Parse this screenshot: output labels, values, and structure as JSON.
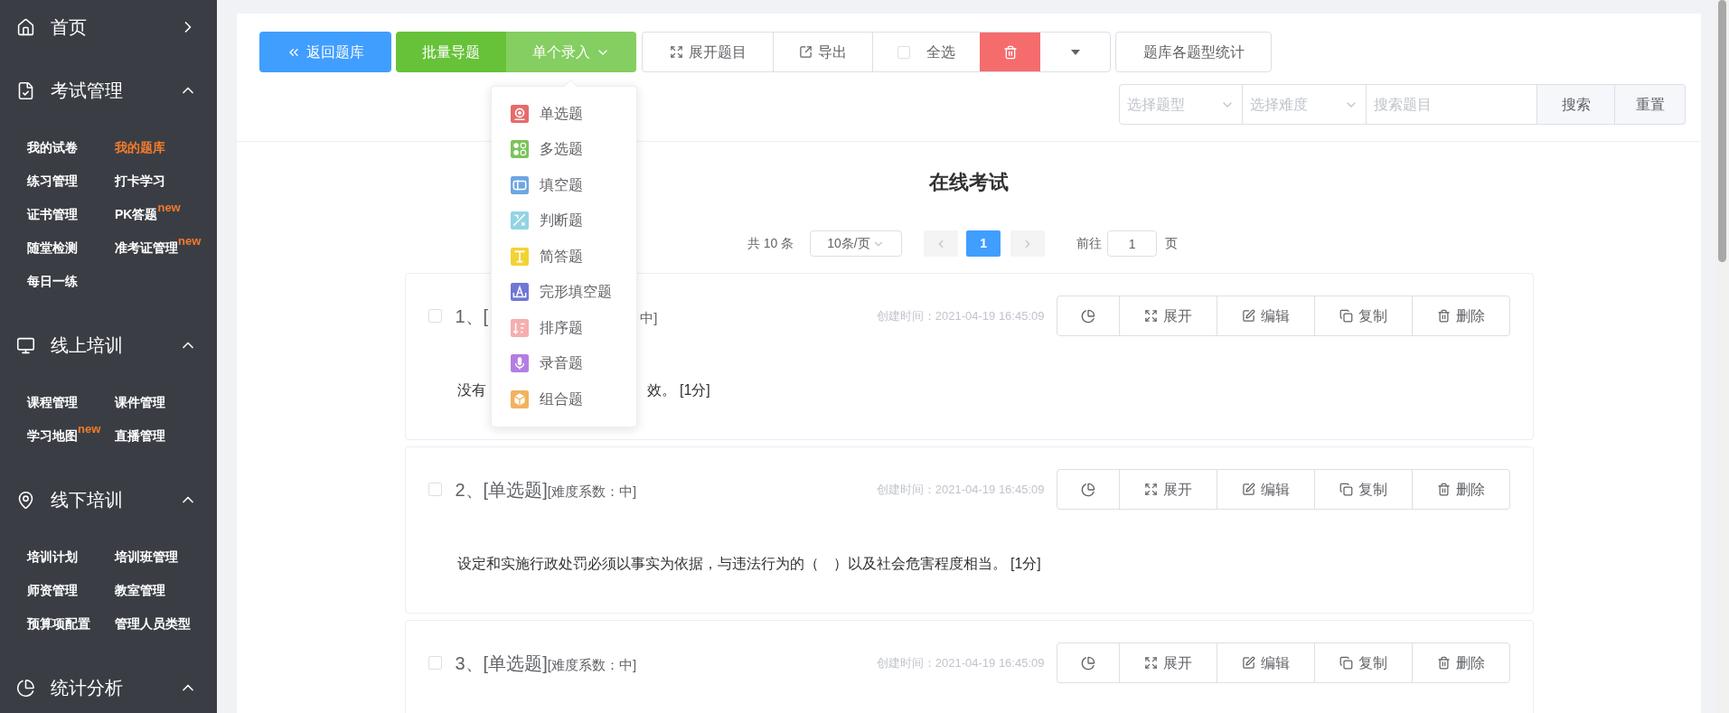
{
  "sidebar": {
    "sections": [
      {
        "label": "首页",
        "expanded": false
      },
      {
        "label": "考试管理",
        "expanded": true,
        "items": [
          {
            "label": "我的试卷",
            "selected": false
          },
          {
            "label": "我的题库",
            "selected": true
          },
          {
            "label": "练习管理",
            "selected": false
          },
          {
            "label": "打卡学习",
            "selected": false
          },
          {
            "label": "证书管理",
            "selected": false
          },
          {
            "label": "PK答题",
            "selected": false,
            "badge": "new"
          },
          {
            "label": "随堂检测",
            "selected": false
          },
          {
            "label": "准考证管理",
            "selected": false,
            "badge": "new"
          },
          {
            "label": "每日一练",
            "selected": false
          }
        ]
      },
      {
        "label": "线上培训",
        "expanded": true,
        "items": [
          {
            "label": "课程管理",
            "selected": false
          },
          {
            "label": "课件管理",
            "selected": false
          },
          {
            "label": "学习地图",
            "selected": false,
            "badge": "new"
          },
          {
            "label": "直播管理",
            "selected": false
          }
        ]
      },
      {
        "label": "线下培训",
        "expanded": true,
        "items": [
          {
            "label": "培训计划",
            "selected": false
          },
          {
            "label": "培训班管理",
            "selected": false
          },
          {
            "label": "师资管理",
            "selected": false
          },
          {
            "label": "教室管理",
            "selected": false
          },
          {
            "label": "预算项配置",
            "selected": false
          },
          {
            "label": "管理人员类型",
            "selected": false
          }
        ]
      },
      {
        "label": "统计分析",
        "expanded": true
      }
    ]
  },
  "toolbar": {
    "back_button": "返回题库",
    "batch_import": "批量导题",
    "single_entry": {
      "label": "单个录入",
      "expanded": true
    },
    "expand_questions": "展开题目",
    "export": "导出",
    "select_all": {
      "label": "全选",
      "checked": false
    },
    "stats": "题库各题型统计"
  },
  "entry_menu": {
    "items": [
      {
        "label": "单选题",
        "kind": "radio",
        "color": "#e56b6b"
      },
      {
        "label": "多选题",
        "kind": "multi",
        "color": "#7cc35c"
      },
      {
        "label": "填空题",
        "kind": "blank",
        "color": "#6fa6e0"
      },
      {
        "label": "判断题",
        "kind": "judge",
        "color": "#93d3e3"
      },
      {
        "label": "简答题",
        "kind": "text",
        "color": "#f3d234"
      },
      {
        "label": "完形填空题",
        "kind": "cloze",
        "color": "#7077d6"
      },
      {
        "label": "排序题",
        "kind": "sort",
        "color": "#f6aeb0"
      },
      {
        "label": "录音题",
        "kind": "audio",
        "color": "#b37ee0"
      },
      {
        "label": "组合题",
        "kind": "combo",
        "color": "#f2b25c"
      }
    ]
  },
  "filters": {
    "type_select": {
      "placeholder": "选择题型"
    },
    "difficulty_select": {
      "placeholder": "选择难度"
    },
    "search": {
      "placeholder": "搜索题目"
    },
    "search_button": "搜索",
    "reset_button": "重置"
  },
  "title": "在线考试",
  "pagination": {
    "total": "共 10 条",
    "page_size": "10条/页",
    "pages": [
      {
        "label": "1",
        "selected": true
      }
    ],
    "goto_label": "前往",
    "goto_value": "1",
    "goto_suffix": "页"
  },
  "questions": [
    {
      "checked": false,
      "covered_by_menu": true,
      "title_parts": [
        {
          "text": "1、[",
          "kind": "type"
        },
        {
          "text": "中]",
          "kind": "difficulty"
        }
      ],
      "created": "创建时间：2021-04-19 16:45:09",
      "actions": [
        "展开",
        "编辑",
        "复制",
        "删除"
      ],
      "body_parts": [
        "没有",
        "效。 [1分]"
      ]
    },
    {
      "checked": false,
      "covered_by_menu": false,
      "title_parts": [
        {
          "text": "2、[单选题]",
          "kind": "type"
        },
        {
          "text": "[难度系数：中]",
          "kind": "difficulty"
        }
      ],
      "created": "创建时间：2021-04-19 16:45:09",
      "actions": [
        "展开",
        "编辑",
        "复制",
        "删除"
      ],
      "body_parts": [
        "设定和实施行政处罚必须以事实为依据，与违法行为的（　）以及社会危害程度相当。 [1分]"
      ]
    },
    {
      "checked": false,
      "covered_by_menu": false,
      "title_parts": [
        {
          "text": "3、[单选题]",
          "kind": "type"
        },
        {
          "text": "[难度系数：中]",
          "kind": "difficulty"
        }
      ],
      "created": "创建时间：2021-04-19 16:45:09",
      "actions": [
        "展开",
        "编辑",
        "复制",
        "删除"
      ]
    }
  ]
}
